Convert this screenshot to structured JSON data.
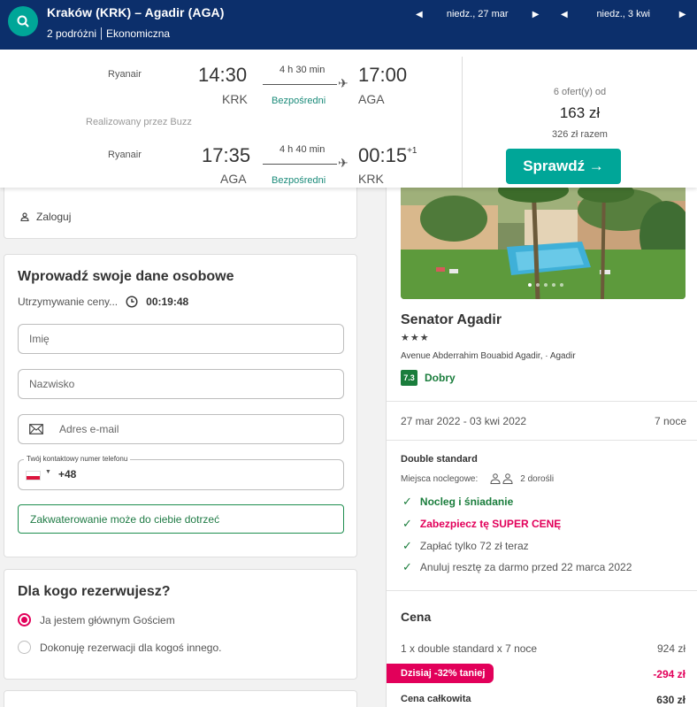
{
  "header": {
    "route": "Kraków (KRK) – Agadir (AGA)",
    "travellers": "2 podróżni",
    "cabin": "Ekonomiczna",
    "depart_date": "niedz., 27 mar",
    "return_date": "niedz., 3 kwi",
    "icons": {
      "search": "search-icon",
      "prev": "caret-left-icon",
      "next": "caret-right-icon"
    }
  },
  "flights": {
    "outbound": {
      "airline": "Ryanair",
      "dep_time": "14:30",
      "dep_code": "KRK",
      "duration": "4 h 30 min",
      "stops": "Bezpośredni",
      "arr_time": "17:00",
      "arr_code": "AGA"
    },
    "operated_by": "Realizowany przez Buzz",
    "inbound": {
      "airline": "Ryanair",
      "dep_time": "17:35",
      "dep_code": "AGA",
      "duration": "4 h 40 min",
      "stops": "Bezpośredni",
      "arr_time": "00:15",
      "arr_day_offset": "+1",
      "arr_code": "KRK"
    },
    "offers": {
      "count": "6 ofert(y) od",
      "price": "163 zł",
      "total": "326 zł razem",
      "button": "Sprawdź →"
    }
  },
  "login": {
    "label": "Zaloguj",
    "icon": "user-icon"
  },
  "personal": {
    "title": "Wprowadź swoje dane osobowe",
    "hold_label": "Utrzymywanie ceny...",
    "hold_timer": "00:19:48",
    "first_name_placeholder": "Imię",
    "last_name_placeholder": "Nazwisko",
    "email_placeholder": "Adres e-mail",
    "phone_label": "Twój kontaktowy numer telefonu",
    "phone_prefix": "+48",
    "hint": "Zakwaterowanie może do ciebie dotrzeć"
  },
  "booking_for": {
    "title": "Dla kogo rezerwujesz?",
    "options": [
      "Ja jestem głównym Gościem",
      "Dokonuję rezerwacji dla kogoś innego."
    ],
    "selected_index": 0
  },
  "hotel": {
    "name": "Senator Agadir",
    "stars": "★★★",
    "star_count": 3,
    "address": "Avenue Abderrahim Bouabid Agadir, · Agadir",
    "rating": "7.3",
    "rating_word": "Dobry",
    "dates": "27 mar 2022 - 03 kwi 2022",
    "nights": "7 noce",
    "room": "Double standard",
    "beds_label": "Miejsca noclegowe:",
    "beds_value": "2 dorośli",
    "features": [
      {
        "text": "Nocleg i śniadanie",
        "style": "green"
      },
      {
        "text": "Zabezpiecz tę SUPER CENĘ",
        "style": "pink"
      },
      {
        "text": "Zapłać tylko 72 zł teraz",
        "style": "plain"
      },
      {
        "text": "Anuluj resztę za darmo przed 22 marca 2022",
        "style": "plain"
      }
    ]
  },
  "price": {
    "title": "Cena",
    "line": "1 x double standard x 7 noce",
    "line_amount": "924 zł",
    "discount_label": "Dzisiaj -32% taniej",
    "discount_amount": "-294 zł",
    "total_label": "Cena całkowita",
    "total_amount": "630 zł"
  },
  "colors": {
    "navy": "#0c2f6b",
    "teal": "#00a698",
    "green": "#1a7d3c",
    "pink": "#e2005a"
  }
}
